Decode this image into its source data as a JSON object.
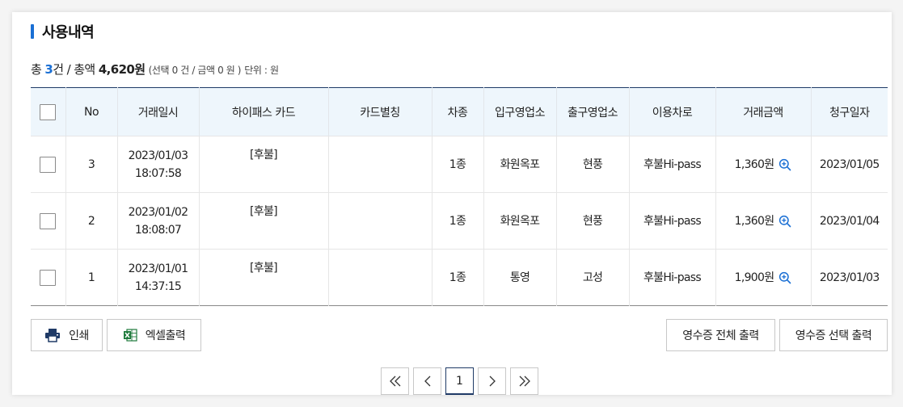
{
  "section": {
    "title": "사용내역"
  },
  "summary": {
    "total_prefix": "총",
    "count": "3",
    "count_unit": "건",
    "separator": "/",
    "amount_label": "총액",
    "amount": "4,620원",
    "selection_note": "(선택 0 건 / 금액 0 원 )",
    "unit_note": "단위 : 원"
  },
  "table": {
    "headers": [
      "No",
      "거래일시",
      "하이패스 카드",
      "카드별칭",
      "차종",
      "입구영업소",
      "출구영업소",
      "이용차로",
      "거래금액",
      "청구일자"
    ],
    "rows": [
      {
        "no": "3",
        "date": "2023/01/03",
        "time": "18:07:58",
        "card": "[후불]",
        "alias": "",
        "car_type": "1종",
        "entry": "화원옥포",
        "exit": "현풍",
        "lane": "후불Hi-pass",
        "amount": "1,360원",
        "bill_date": "2023/01/05"
      },
      {
        "no": "2",
        "date": "2023/01/02",
        "time": "18:08:07",
        "card": "[후불]",
        "alias": "",
        "car_type": "1종",
        "entry": "화원옥포",
        "exit": "현풍",
        "lane": "후불Hi-pass",
        "amount": "1,360원",
        "bill_date": "2023/01/04"
      },
      {
        "no": "1",
        "date": "2023/01/01",
        "time": "14:37:15",
        "card": "[후불]",
        "alias": "",
        "car_type": "1종",
        "entry": "통영",
        "exit": "고성",
        "lane": "후불Hi-pass",
        "amount": "1,900원",
        "bill_date": "2023/01/03"
      }
    ]
  },
  "buttons": {
    "print": "인쇄",
    "excel": "엑셀출력",
    "receipt_all": "영수증 전체 출력",
    "receipt_selected": "영수증 선택 출력"
  },
  "pagination": {
    "current": "1"
  },
  "icons": {
    "print": "printer-icon",
    "excel": "excel-icon",
    "zoom": "zoom-in-icon",
    "first": "double-chevron-left-icon",
    "prev": "chevron-left-icon",
    "next": "chevron-right-icon",
    "last": "double-chevron-right-icon"
  },
  "colors": {
    "accent": "#1a6fd4",
    "header_bg": "#eef6fc",
    "header_border": "#1f3a66",
    "excel_green": "#1e7a3c"
  }
}
